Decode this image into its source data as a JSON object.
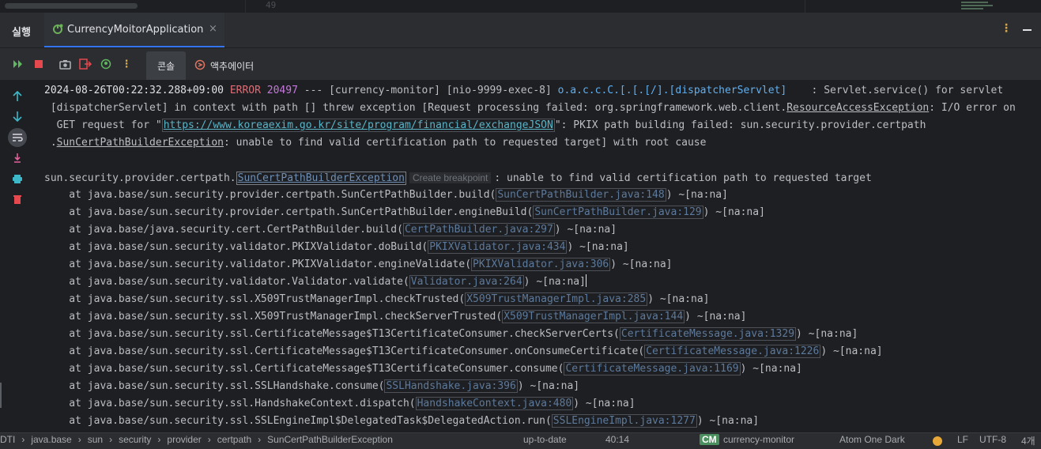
{
  "editor": {
    "line_number": "49"
  },
  "tool_window": {
    "title": "실행",
    "run_tab_label": "CurrencyMoitorApplication",
    "close_glyph": "×",
    "icons": {
      "run_config": "spring-boot-run-icon",
      "more": "more-vertical-icon",
      "minimize": "minimize-icon"
    }
  },
  "toolbar": {
    "subtabs": [
      {
        "label": "콘솔",
        "active": true
      },
      {
        "label": "액추에이터",
        "active": false
      }
    ],
    "icons": [
      "rerun-icon",
      "stop-icon",
      "screenshot-icon",
      "exit-icon",
      "debug-icon",
      "more-icon"
    ]
  },
  "left_actions": [
    "up-arrow-icon",
    "down-arrow-icon",
    "soft-wrap-icon",
    "scroll-to-end-icon",
    "print-icon",
    "trash-icon"
  ],
  "colors": {
    "accent": "#3574f0",
    "error": "#e06c75",
    "pid": "#c678dd",
    "logger": "#61afef",
    "link": "#5ab4c8",
    "stop": "#e5484d",
    "trash": "#e5484d"
  },
  "console": {
    "log_line": {
      "timestamp": "2024-08-26T00:22:32.288+09:00",
      "level": "ERROR",
      "pid": "20497",
      "separator": " --- ",
      "thread_info": "[currency-monitor] [nio-9999-exec-8] ",
      "logger": "o.a.c.c.C.[.[.[/].[dispatcherServlet]",
      "message_tail": "    : Servlet.service() for servlet"
    },
    "line2_prefix": " [dispatcherServlet] in context with path [] threw exception [Request processing failed: org.springframework.web.client.",
    "line2_exception": "ResourceAccessException",
    "line2_suffix": ": I/O error on",
    "line3_prefix": "  GET request for \"",
    "line3_url": "https://www.koreaexim.go.kr/site/program/financial/exchangeJSON",
    "line3_suffix": "\": PKIX path building failed: sun.security.provider.certpath",
    "line4_prefix": " .",
    "line4_exception": "SunCertPathBuilderException",
    "line4_suffix": ": unable to find valid certification path to requested target] with root cause",
    "cause_prefix": "sun.security.provider.certpath.",
    "cause_exception": "SunCertPathBuilderException",
    "breakpoint_hint": "Create breakpoint",
    "cause_suffix": ": unable to find valid certification path to requested target",
    "stack": [
      {
        "method": "    at java.base/sun.security.provider.certpath.SunCertPathBuilder.build(",
        "file": "SunCertPathBuilder.java:148",
        "tail": ") ~[na:na]"
      },
      {
        "method": "    at java.base/sun.security.provider.certpath.SunCertPathBuilder.engineBuild(",
        "file": "SunCertPathBuilder.java:129",
        "tail": ") ~[na:na]"
      },
      {
        "method": "    at java.base/java.security.cert.CertPathBuilder.build(",
        "file": "CertPathBuilder.java:297",
        "tail": ") ~[na:na]"
      },
      {
        "method": "    at java.base/sun.security.validator.PKIXValidator.doBuild(",
        "file": "PKIXValidator.java:434",
        "tail": ") ~[na:na]"
      },
      {
        "method": "    at java.base/sun.security.validator.PKIXValidator.engineValidate(",
        "file": "PKIXValidator.java:306",
        "tail": ") ~[na:na]"
      },
      {
        "method": "    at java.base/sun.security.validator.Validator.validate(",
        "file": "Validator.java:264",
        "tail": ") ~[na:na]"
      },
      {
        "method": "    at java.base/sun.security.ssl.X509TrustManagerImpl.checkTrusted(",
        "file": "X509TrustManagerImpl.java:285",
        "tail": ") ~[na:na]"
      },
      {
        "method": "    at java.base/sun.security.ssl.X509TrustManagerImpl.checkServerTrusted(",
        "file": "X509TrustManagerImpl.java:144",
        "tail": ") ~[na:na]"
      },
      {
        "method": "    at java.base/sun.security.ssl.CertificateMessage$T13CertificateConsumer.checkServerCerts(",
        "file": "CertificateMessage.java:1329",
        "tail": ") ~[na:na]"
      },
      {
        "method": "    at java.base/sun.security.ssl.CertificateMessage$T13CertificateConsumer.onConsumeCertificate(",
        "file": "CertificateMessage.java:1226",
        "tail": ") ~[na:na]"
      },
      {
        "method": "    at java.base/sun.security.ssl.CertificateMessage$T13CertificateConsumer.consume(",
        "file": "CertificateMessage.java:1169",
        "tail": ") ~[na:na]"
      },
      {
        "method": "    at java.base/sun.security.ssl.SSLHandshake.consume(",
        "file": "SSLHandshake.java:396",
        "tail": ") ~[na:na]"
      },
      {
        "method": "    at java.base/sun.security.ssl.HandshakeContext.dispatch(",
        "file": "HandshakeContext.java:480",
        "tail": ") ~[na:na]"
      },
      {
        "method": "    at java.base/sun.security.ssl.SSLEngineImpl$DelegatedTask$DelegatedAction.run(",
        "file": "SSLEngineImpl.java:1277",
        "tail": ") ~[na:na]"
      }
    ]
  },
  "status_bar": {
    "breadcrumb": [
      "DTI",
      "java.base",
      "sun",
      "security",
      "provider",
      "certpath",
      "SunCertPathBuilderException"
    ],
    "vcs": "up-to-date",
    "position": "40:14",
    "project_badge": "CM",
    "project_name": "currency-monitor",
    "theme": "Atom One Dark",
    "line_sep": "LF",
    "encoding": "UTF-8",
    "indent": "4개"
  }
}
